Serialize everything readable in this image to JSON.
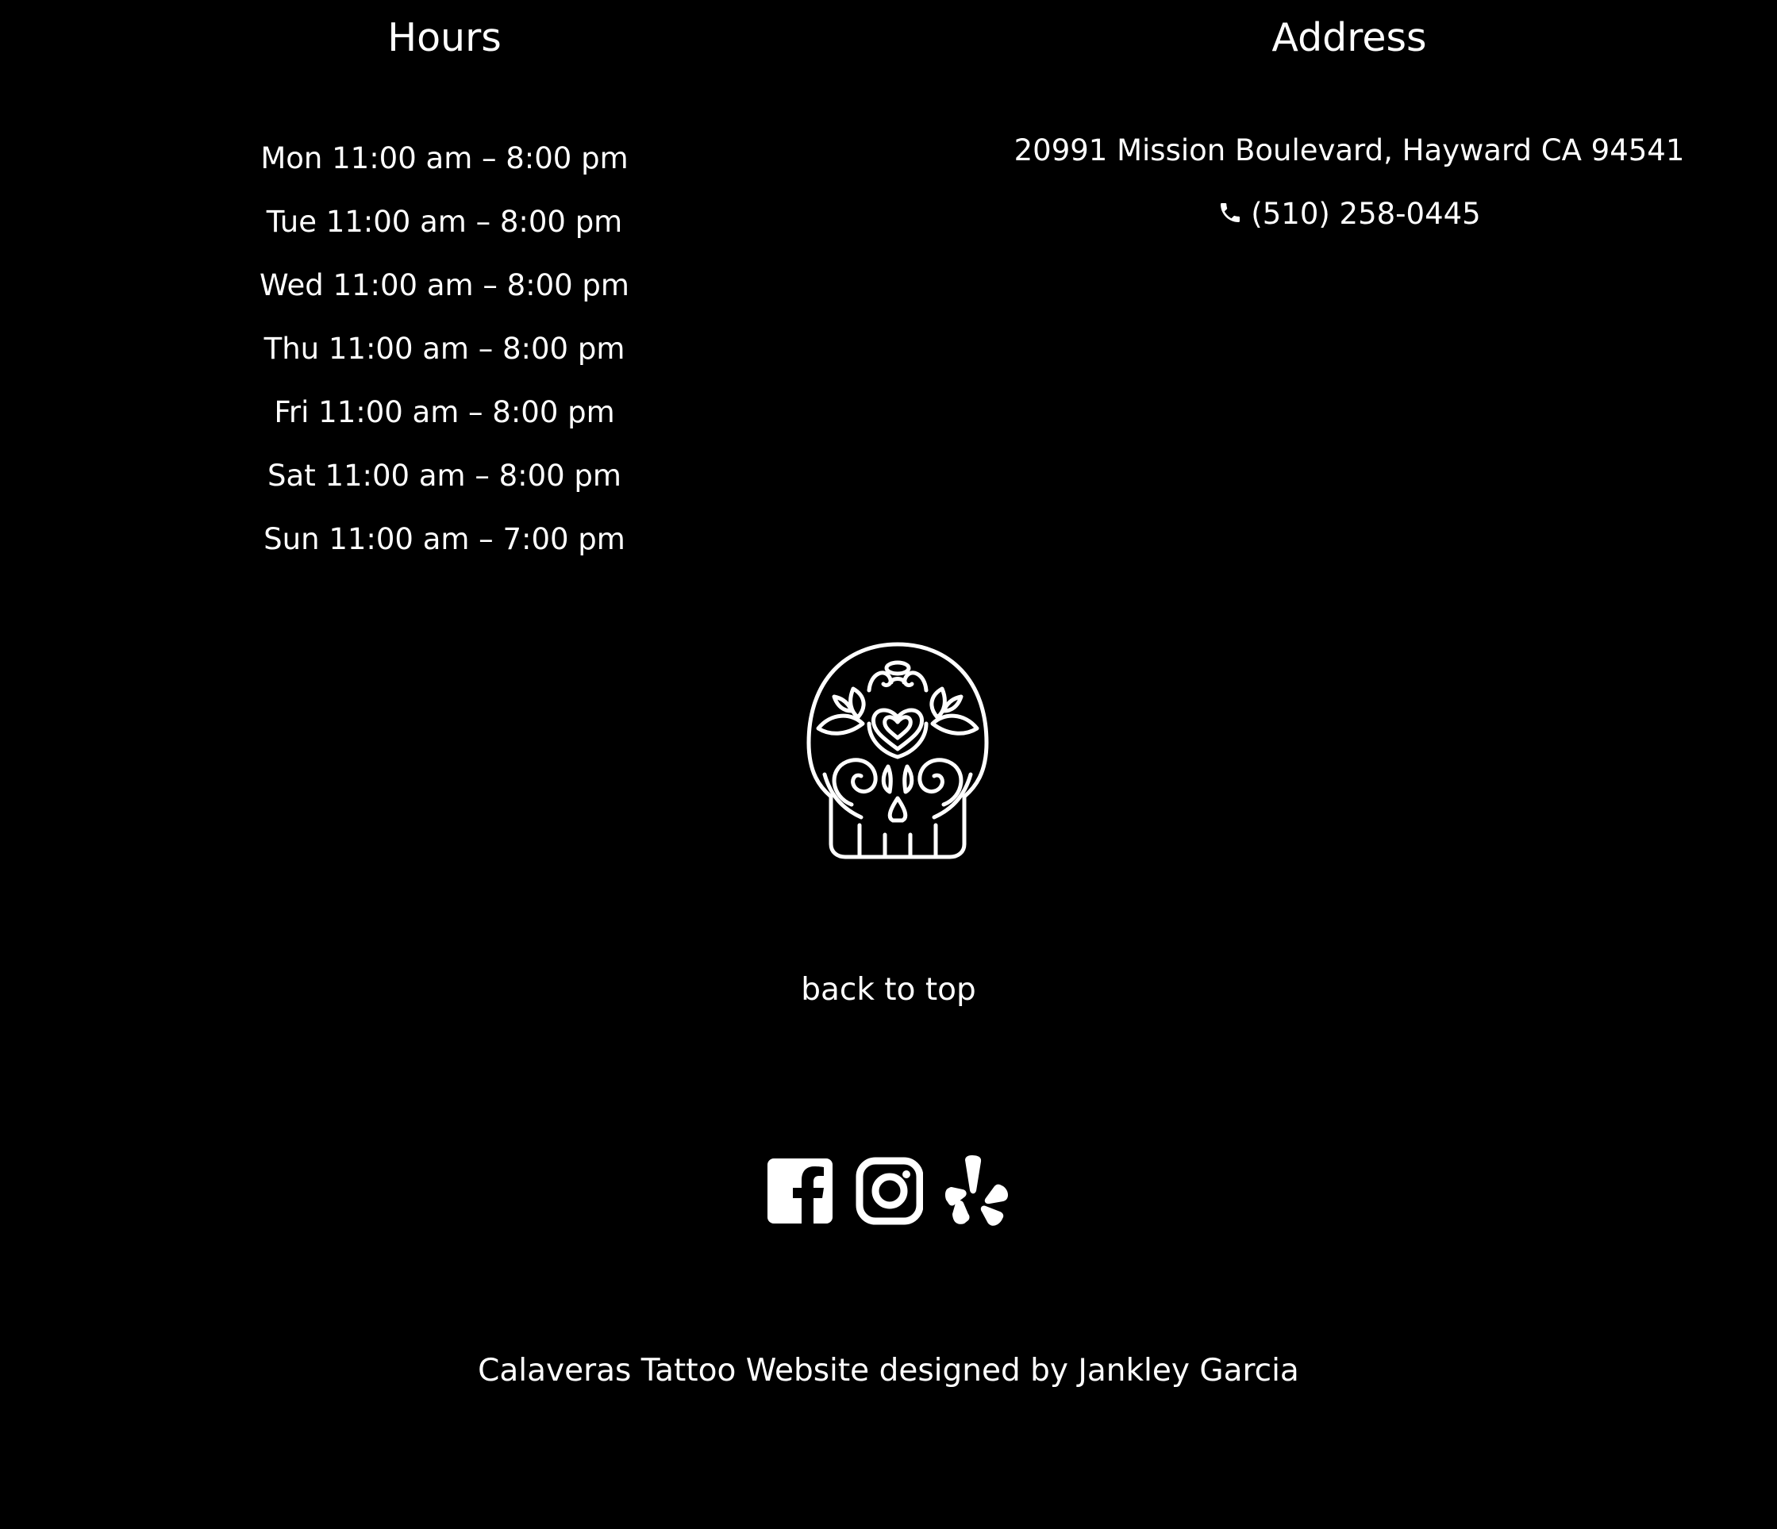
{
  "hours": {
    "heading": "Hours",
    "days": [
      {
        "label": "Mon 11:00 am – 8:00 pm"
      },
      {
        "label": "Tue 11:00 am – 8:00 pm"
      },
      {
        "label": "Wed 11:00 am – 8:00 pm"
      },
      {
        "label": "Thu 11:00 am – 8:00 pm"
      },
      {
        "label": "Fri 11:00 am – 8:00 pm"
      },
      {
        "label": "Sat 11:00 am – 8:00 pm"
      },
      {
        "label": "Sun 11:00 am – 7:00 pm"
      }
    ]
  },
  "address": {
    "heading": "Address",
    "street": "20991 Mission Boulevard, Hayward CA 94541",
    "phone": "(510) 258-0445",
    "phone_icon": "phone-icon"
  },
  "logo": {
    "icon": "sugar-skull-icon"
  },
  "nav": {
    "back_to_top": "back to top"
  },
  "social": {
    "icons": [
      "facebook-icon",
      "instagram-icon",
      "yelp-icon"
    ]
  },
  "footer": {
    "credit": "Calaveras Tattoo Website designed by Jankley Garcia"
  },
  "colors": {
    "background": "#000000",
    "text": "#ffffff"
  }
}
